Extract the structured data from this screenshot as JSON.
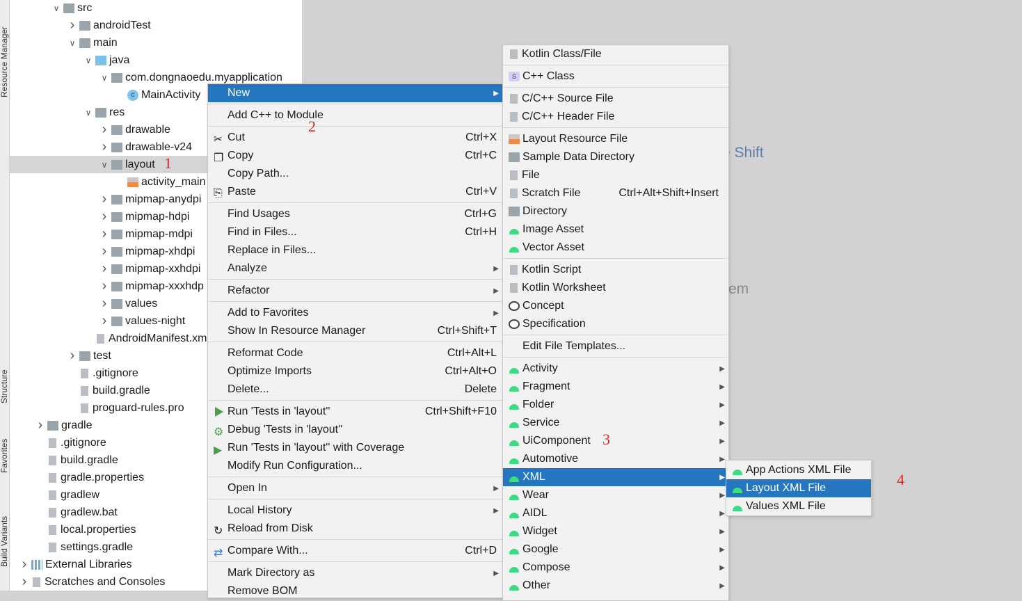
{
  "tool_strip": [
    "Resource Manager",
    "Structure",
    "Favorites",
    "Build Variants"
  ],
  "tree": [
    {
      "label": "src",
      "level": 2,
      "state": "open",
      "icon": "folder"
    },
    {
      "label": "androidTest",
      "level": 3,
      "state": "closed",
      "icon": "folder"
    },
    {
      "label": "main",
      "level": 3,
      "state": "open",
      "icon": "folder"
    },
    {
      "label": "java",
      "level": 4,
      "state": "open",
      "icon": "folder-blue"
    },
    {
      "label": "com.dongnaoedu.myapplication",
      "level": 5,
      "state": "open",
      "icon": "folder"
    },
    {
      "label": "MainActivity",
      "level": 6,
      "state": "leaf",
      "icon": "class"
    },
    {
      "label": "res",
      "level": 4,
      "state": "open",
      "icon": "folder"
    },
    {
      "label": "drawable",
      "level": 5,
      "state": "closed",
      "icon": "folder"
    },
    {
      "label": "drawable-v24",
      "level": 5,
      "state": "closed",
      "icon": "folder"
    },
    {
      "label": "layout",
      "level": 5,
      "state": "open",
      "icon": "folder",
      "selected": true
    },
    {
      "label": "activity_main",
      "level": 6,
      "state": "leaf",
      "icon": "layout"
    },
    {
      "label": "mipmap-anydpi",
      "level": 5,
      "state": "closed",
      "icon": "folder"
    },
    {
      "label": "mipmap-hdpi",
      "level": 5,
      "state": "closed",
      "icon": "folder"
    },
    {
      "label": "mipmap-mdpi",
      "level": 5,
      "state": "closed",
      "icon": "folder"
    },
    {
      "label": "mipmap-xhdpi",
      "level": 5,
      "state": "closed",
      "icon": "folder"
    },
    {
      "label": "mipmap-xxhdpi",
      "level": 5,
      "state": "closed",
      "icon": "folder"
    },
    {
      "label": "mipmap-xxxhdp",
      "level": 5,
      "state": "closed",
      "icon": "folder"
    },
    {
      "label": "values",
      "level": 5,
      "state": "closed",
      "icon": "folder"
    },
    {
      "label": "values-night",
      "level": 5,
      "state": "closed",
      "icon": "folder"
    },
    {
      "label": "AndroidManifest.xml",
      "level": 4,
      "state": "leaf",
      "icon": "file"
    },
    {
      "label": "test",
      "level": 3,
      "state": "closed",
      "icon": "folder"
    },
    {
      "label": ".gitignore",
      "level": 3,
      "state": "leaf",
      "icon": "file"
    },
    {
      "label": "build.gradle",
      "level": 3,
      "state": "leaf",
      "icon": "file"
    },
    {
      "label": "proguard-rules.pro",
      "level": 3,
      "state": "leaf",
      "icon": "file"
    },
    {
      "label": "gradle",
      "level": 1,
      "state": "closed",
      "icon": "folder"
    },
    {
      "label": ".gitignore",
      "level": 1,
      "state": "leaf",
      "icon": "file"
    },
    {
      "label": "build.gradle",
      "level": 1,
      "state": "leaf",
      "icon": "file"
    },
    {
      "label": "gradle.properties",
      "level": 1,
      "state": "leaf",
      "icon": "file"
    },
    {
      "label": "gradlew",
      "level": 1,
      "state": "leaf",
      "icon": "file"
    },
    {
      "label": "gradlew.bat",
      "level": 1,
      "state": "leaf",
      "icon": "file"
    },
    {
      "label": "local.properties",
      "level": 1,
      "state": "leaf",
      "icon": "file"
    },
    {
      "label": "settings.gradle",
      "level": 1,
      "state": "leaf",
      "icon": "file"
    },
    {
      "label": "External Libraries",
      "level": 0,
      "state": "closed",
      "icon": "lib"
    },
    {
      "label": "Scratches and Consoles",
      "level": 0,
      "state": "closed",
      "icon": "file"
    }
  ],
  "context_menu": [
    {
      "label": "New",
      "submenu": true,
      "highlighted": true
    },
    {
      "sep": true
    },
    {
      "label": "Add C++ to Module"
    },
    {
      "sep": true
    },
    {
      "label": "Cut",
      "shortcut": "Ctrl+X",
      "icon": "scissors"
    },
    {
      "label": "Copy",
      "shortcut": "Ctrl+C",
      "icon": "copy"
    },
    {
      "label": "Copy Path..."
    },
    {
      "label": "Paste",
      "shortcut": "Ctrl+V",
      "icon": "paste"
    },
    {
      "sep": true
    },
    {
      "label": "Find Usages",
      "shortcut": "Ctrl+G"
    },
    {
      "label": "Find in Files...",
      "shortcut": "Ctrl+H"
    },
    {
      "label": "Replace in Files..."
    },
    {
      "label": "Analyze",
      "submenu": true
    },
    {
      "sep": true
    },
    {
      "label": "Refactor",
      "submenu": true
    },
    {
      "sep": true
    },
    {
      "label": "Add to Favorites",
      "submenu": true
    },
    {
      "label": "Show In Resource Manager",
      "shortcut": "Ctrl+Shift+T"
    },
    {
      "sep": true
    },
    {
      "label": "Reformat Code",
      "shortcut": "Ctrl+Alt+L"
    },
    {
      "label": "Optimize Imports",
      "shortcut": "Ctrl+Alt+O"
    },
    {
      "label": "Delete...",
      "shortcut": "Delete"
    },
    {
      "sep": true
    },
    {
      "label": "Run 'Tests in 'layout''",
      "shortcut": "Ctrl+Shift+F10",
      "icon": "play"
    },
    {
      "label": "Debug 'Tests in 'layout''",
      "icon": "bug"
    },
    {
      "label": "Run 'Tests in 'layout'' with Coverage",
      "icon": "coverage"
    },
    {
      "label": "Modify Run Configuration..."
    },
    {
      "sep": true
    },
    {
      "label": "Open In",
      "submenu": true
    },
    {
      "sep": true
    },
    {
      "label": "Local History",
      "submenu": true
    },
    {
      "label": "Reload from Disk",
      "icon": "reload"
    },
    {
      "sep": true
    },
    {
      "label": "Compare With...",
      "shortcut": "Ctrl+D",
      "icon": "compare"
    },
    {
      "sep": true
    },
    {
      "label": "Mark Directory as",
      "submenu": true
    },
    {
      "label": "Remove BOM"
    }
  ],
  "new_submenu": [
    {
      "label": "Kotlin Class/File",
      "icon": "kotlin-file"
    },
    {
      "sep": true
    },
    {
      "label": "C++ Class",
      "icon": "cpp-class"
    },
    {
      "sep": true
    },
    {
      "label": "C/C++ Source File",
      "icon": "cpp-source"
    },
    {
      "label": "C/C++ Header File",
      "icon": "cpp-header"
    },
    {
      "sep": true
    },
    {
      "label": "Layout Resource File",
      "icon": "layout-file"
    },
    {
      "label": "Sample Data Directory",
      "icon": "folder"
    },
    {
      "label": "File",
      "icon": "file"
    },
    {
      "label": "Scratch File",
      "shortcut": "Ctrl+Alt+Shift+Insert",
      "icon": "scratch"
    },
    {
      "label": "Directory",
      "icon": "folder"
    },
    {
      "label": "Image Asset",
      "icon": "android"
    },
    {
      "label": "Vector Asset",
      "icon": "android"
    },
    {
      "sep": true
    },
    {
      "label": "Kotlin Script",
      "icon": "kotlin-file"
    },
    {
      "label": "Kotlin Worksheet",
      "icon": "kotlin-file"
    },
    {
      "label": "Concept",
      "icon": "concept"
    },
    {
      "label": "Specification",
      "icon": "concept"
    },
    {
      "sep": true
    },
    {
      "label": "Edit File Templates..."
    },
    {
      "sep": true
    },
    {
      "label": "Activity",
      "icon": "android",
      "submenu": true
    },
    {
      "label": "Fragment",
      "icon": "android",
      "submenu": true
    },
    {
      "label": "Folder",
      "icon": "android",
      "submenu": true
    },
    {
      "label": "Service",
      "icon": "android",
      "submenu": true
    },
    {
      "label": "UiComponent",
      "icon": "android",
      "submenu": true
    },
    {
      "label": "Automotive",
      "icon": "android",
      "submenu": true
    },
    {
      "label": "XML",
      "icon": "android",
      "submenu": true,
      "highlighted": true
    },
    {
      "label": "Wear",
      "icon": "android",
      "submenu": true
    },
    {
      "label": "AIDL",
      "icon": "android",
      "submenu": true
    },
    {
      "label": "Widget",
      "icon": "android",
      "submenu": true
    },
    {
      "label": "Google",
      "icon": "android",
      "submenu": true
    },
    {
      "label": "Compose",
      "icon": "android",
      "submenu": true
    },
    {
      "label": "Other",
      "icon": "android",
      "submenu": true
    }
  ],
  "xml_submenu": [
    {
      "label": "App Actions XML File",
      "icon": "android-file"
    },
    {
      "label": "Layout XML File",
      "icon": "android-file",
      "highlighted": true
    },
    {
      "label": "Values XML File",
      "icon": "android-file"
    }
  ],
  "annotations": [
    "1",
    "2",
    "3",
    "4"
  ],
  "background_text": [
    "e Shift",
    "em"
  ],
  "colors": {
    "highlight": "#2675bf",
    "annotation": "#e02020",
    "android": "#3ddc84"
  }
}
